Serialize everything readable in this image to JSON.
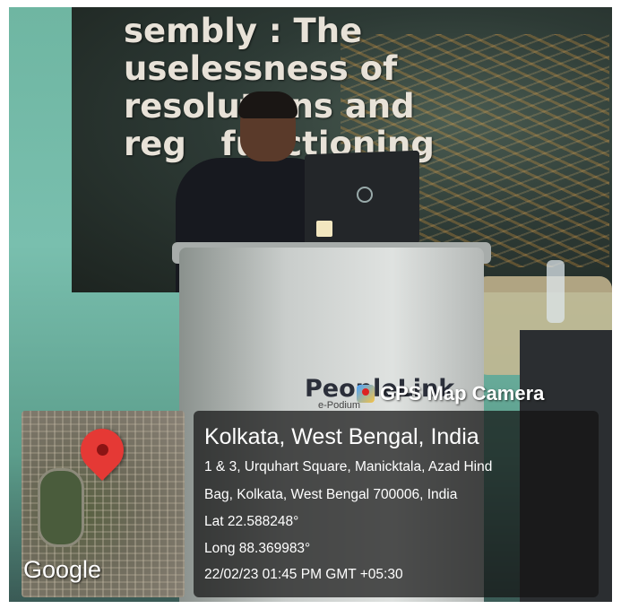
{
  "photo": {
    "slide_text": "sembly : The\nuselessness of\nresolutions and\nreg   functioning",
    "podium_brand": "PeopleLink",
    "podium_sub": "e-Podium"
  },
  "overlay": {
    "app_name": "GPS Map Camera",
    "icon": "gps-map-camera-app-icon",
    "city": "Kolkata, West Bengal, India",
    "address_line1": "1 & 3, Urquhart Square, Manicktala, Azad Hind",
    "address_line2": "Bag, Kolkata, West Bengal 700006, India",
    "latitude": "Lat 22.588248°",
    "longitude": "Long 88.369983°",
    "timestamp": "22/02/23 01:45 PM GMT +05:30",
    "map_brand": "Google",
    "pin_color": "#e53935"
  }
}
